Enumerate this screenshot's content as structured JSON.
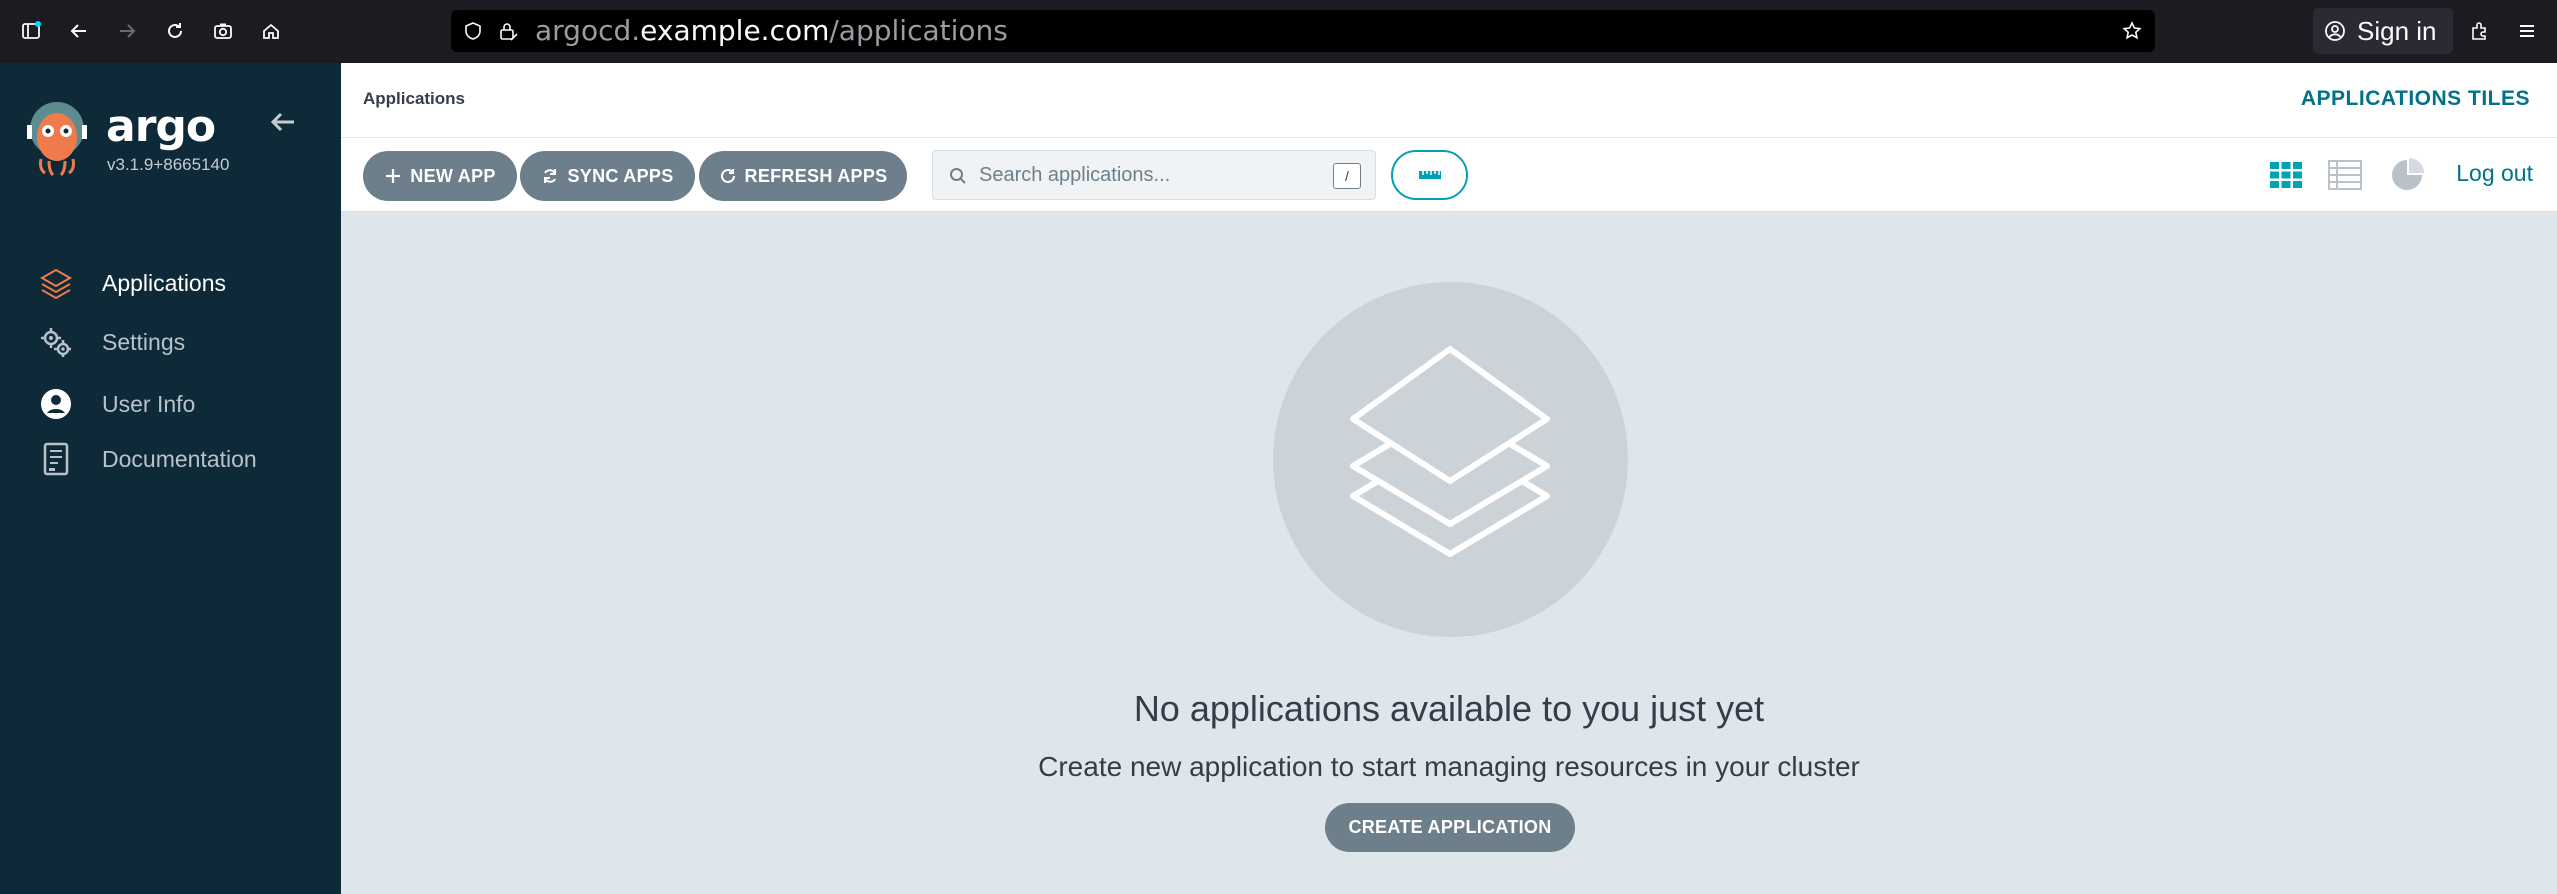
{
  "browser": {
    "url_host_prefix": "argocd.",
    "url_host": "example.com",
    "url_path": "/applications",
    "signin_label": "Sign in"
  },
  "sidebar": {
    "brand": "argo",
    "version": "v3.1.9+8665140",
    "items": [
      {
        "label": "Applications",
        "icon": "layers-icon",
        "active": true
      },
      {
        "label": "Settings",
        "icon": "gears-icon",
        "active": false
      },
      {
        "label": "User Info",
        "icon": "user-circle-icon",
        "active": false
      },
      {
        "label": "Documentation",
        "icon": "book-icon",
        "active": false
      }
    ]
  },
  "header": {
    "breadcrumb": "Applications",
    "title": "APPLICATIONS TILES"
  },
  "toolbar": {
    "new_app": "NEW APP",
    "sync_apps": "SYNC APPS",
    "refresh_apps": "REFRESH APPS",
    "search_placeholder": "Search applications...",
    "search_shortcut": "/",
    "logout": "Log out"
  },
  "empty_state": {
    "title": "No applications available to you just yet",
    "subtitle": "Create new application to start managing resources in your cluster",
    "create_button": "CREATE APPLICATION"
  },
  "colors": {
    "sidebar_bg": "#0e2a38",
    "accent": "#00a2b3",
    "accent_text": "#00728a",
    "button_gray": "#6d7f8b",
    "content_bg": "#dee6eb"
  }
}
